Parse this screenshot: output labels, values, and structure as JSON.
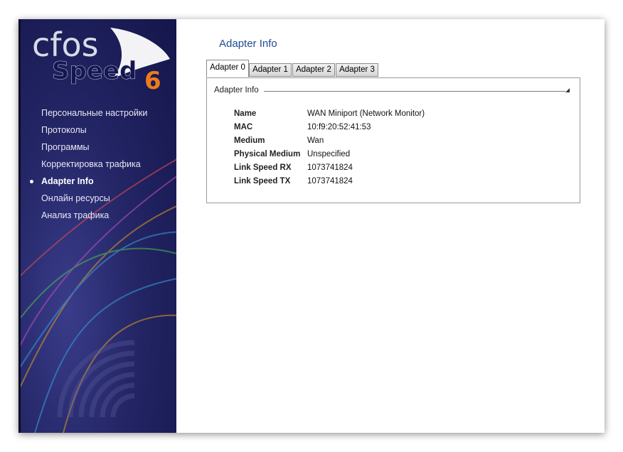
{
  "app": {
    "logo_text_1": "cfos",
    "logo_text_2": "Speed",
    "logo_version": "6"
  },
  "sidebar": {
    "items": [
      {
        "label": "Персональные настройки",
        "active": false
      },
      {
        "label": "Протоколы",
        "active": false
      },
      {
        "label": "Программы",
        "active": false
      },
      {
        "label": "Корректировка трафика",
        "active": false
      },
      {
        "label": "Adapter Info",
        "active": true
      },
      {
        "label": "Онлайн ресурсы",
        "active": false
      },
      {
        "label": "Анализ трафика",
        "active": false
      }
    ]
  },
  "main": {
    "title": "Adapter Info",
    "tabs": [
      {
        "label": "Adapter 0",
        "active": true
      },
      {
        "label": "Adapter 1",
        "active": false
      },
      {
        "label": "Adapter 2",
        "active": false
      },
      {
        "label": "Adapter 3",
        "active": false
      }
    ],
    "group_label": "Adapter Info",
    "rows": [
      {
        "key": "Name",
        "value": "WAN Miniport (Network Monitor)"
      },
      {
        "key": "MAC",
        "value": "10:f9:20:52:41:53"
      },
      {
        "key": "Medium",
        "value": "Wan"
      },
      {
        "key": "Physical Medium",
        "value": "Unspecified"
      },
      {
        "key": "Link Speed RX",
        "value": "1073741824"
      },
      {
        "key": "Link Speed TX",
        "value": "1073741824"
      }
    ]
  },
  "colors": {
    "accent": "#1f4a96",
    "sidebar_bg": "#232565",
    "logo_orange": "#f07a1a"
  }
}
